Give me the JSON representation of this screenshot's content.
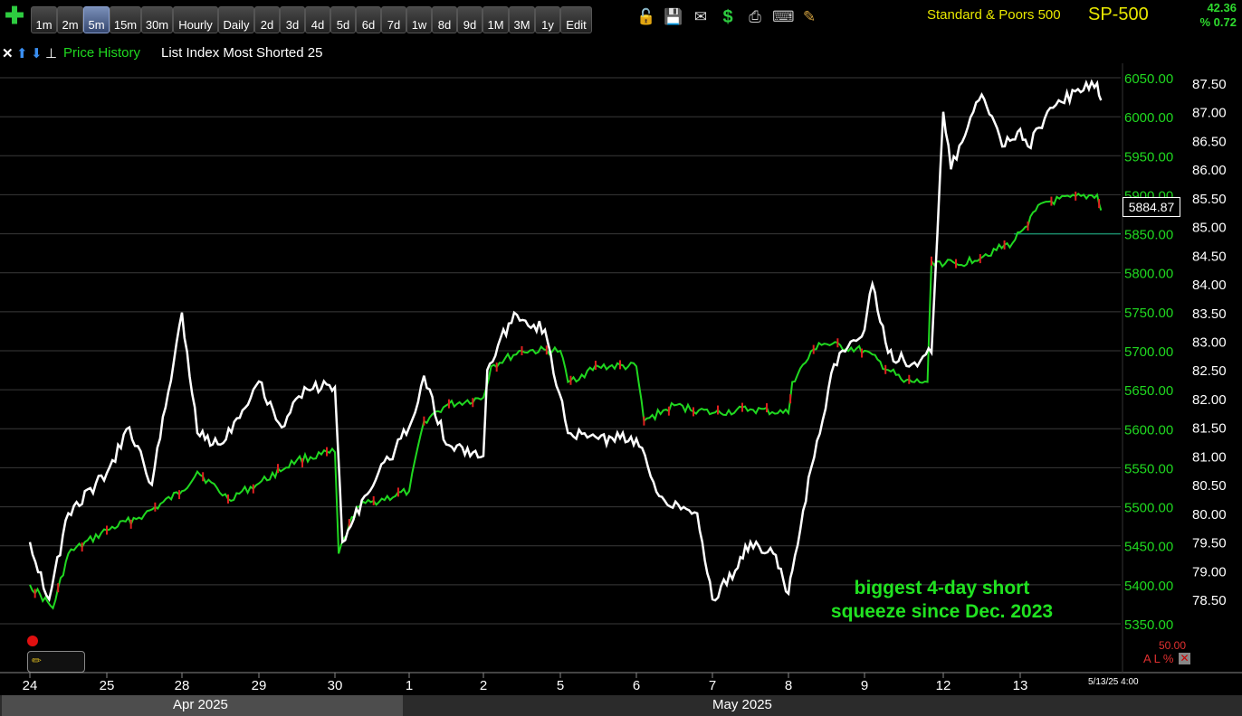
{
  "toolbar": {
    "timeframes": [
      "1m",
      "2m",
      "5m",
      "15m",
      "30m",
      "Hourly",
      "Daily",
      "2d",
      "3d",
      "4d",
      "5d",
      "6d",
      "7d",
      "1w",
      "8d",
      "9d",
      "1M",
      "3M",
      "1y",
      "Edit"
    ],
    "active": "5m",
    "icons": [
      "plus-icon",
      "lock-icon",
      "save-icon",
      "mail-icon",
      "dollar-icon",
      "print-icon",
      "keyboard-icon",
      "pencil-icon"
    ],
    "symbol_name": "Standard & Poors 500",
    "symbol": "SP-500",
    "change": "42.36",
    "change_pct": "% 0.72",
    "accent": "#e8e800",
    "up_color": "#2edb2e"
  },
  "legend": {
    "icons": [
      "close-icon",
      "arrow-up-icon",
      "arrow-down-icon",
      "pin-icon"
    ],
    "series1": "Price History",
    "series2": "List Index Most Shorted 25"
  },
  "annotation": "biggest 4-day short squeeze since Dec. 2023",
  "last_value": "5884.87",
  "pct_value": "50.00",
  "al_label": "A L %",
  "timestamp": "5/13/25 4:00",
  "months": [
    "Apr 2025",
    "May 2025"
  ],
  "chart_data": {
    "type": "line",
    "x_days": [
      "24",
      "25",
      "28",
      "29",
      "30",
      "1",
      "2",
      "5",
      "6",
      "7",
      "8",
      "9",
      "12",
      "13"
    ],
    "y_left": {
      "label": "",
      "ticks": [
        "6050.00",
        "6000.00",
        "5950.00",
        "5900.00",
        "5850.00",
        "5800.00",
        "5750.00",
        "5700.00",
        "5650.00",
        "5600.00",
        "5550.00",
        "5500.00",
        "5450.00",
        "5400.00",
        "5350.00"
      ],
      "range": [
        5350,
        6050
      ]
    },
    "y_right": {
      "label": "",
      "ticks": [
        "87.50",
        "87.00",
        "86.50",
        "86.00",
        "85.50",
        "85.00",
        "84.50",
        "84.00",
        "83.50",
        "83.00",
        "82.50",
        "82.00",
        "81.50",
        "81.00",
        "80.50",
        "80.00",
        "79.50",
        "79.00",
        "78.50"
      ],
      "range": [
        78.5,
        87.5
      ]
    },
    "series": [
      {
        "name": "Price History",
        "axis": "left",
        "color": "#20d820",
        "values": [
          [
            0,
            5400
          ],
          [
            0.3,
            5370
          ],
          [
            0.5,
            5440
          ],
          [
            1,
            5470
          ],
          [
            1.5,
            5490
          ],
          [
            2,
            5520
          ],
          [
            2.2,
            5545
          ],
          [
            2.6,
            5510
          ],
          [
            3,
            5530
          ],
          [
            3.5,
            5560
          ],
          [
            4,
            5570
          ],
          [
            4.05,
            5440
          ],
          [
            4.3,
            5500
          ],
          [
            5,
            5520
          ],
          [
            5.2,
            5610
          ],
          [
            5.5,
            5630
          ],
          [
            6,
            5640
          ],
          [
            6.1,
            5680
          ],
          [
            6.5,
            5700
          ],
          [
            7,
            5700
          ],
          [
            7.1,
            5660
          ],
          [
            7.5,
            5680
          ],
          [
            8,
            5680
          ],
          [
            8.1,
            5610
          ],
          [
            8.5,
            5630
          ],
          [
            9,
            5620
          ],
          [
            9.5,
            5625
          ],
          [
            10,
            5620
          ],
          [
            10.05,
            5660
          ],
          [
            10.4,
            5710
          ],
          [
            11,
            5700
          ],
          [
            11.5,
            5660
          ],
          [
            11.8,
            5660
          ],
          [
            11.85,
            5815
          ],
          [
            12.2,
            5810
          ],
          [
            12.9,
            5838
          ],
          [
            13,
            5852
          ],
          [
            13.3,
            5890
          ],
          [
            14,
            5900
          ],
          [
            14.05,
            5880
          ]
        ]
      },
      {
        "name": "List Index Most Shorted 25",
        "axis": "right",
        "color": "#ffffff",
        "values": [
          [
            0,
            79.5
          ],
          [
            0.25,
            78.5
          ],
          [
            0.5,
            80
          ],
          [
            1,
            80.7
          ],
          [
            1.3,
            81.5
          ],
          [
            1.6,
            80.5
          ],
          [
            2,
            83.5
          ],
          [
            2.2,
            81.4
          ],
          [
            2.5,
            81.2
          ],
          [
            3,
            82.3
          ],
          [
            3.3,
            81.5
          ],
          [
            3.6,
            82.2
          ],
          [
            4,
            82.2
          ],
          [
            4.1,
            79.5
          ],
          [
            4.4,
            80.3
          ],
          [
            5,
            81.5
          ],
          [
            5.2,
            82.4
          ],
          [
            5.5,
            81.2
          ],
          [
            6,
            81
          ],
          [
            6.05,
            82.5
          ],
          [
            6.4,
            83.5
          ],
          [
            6.8,
            83.2
          ],
          [
            7.1,
            81.4
          ],
          [
            7.5,
            81.3
          ],
          [
            8,
            81.3
          ],
          [
            8.3,
            80.3
          ],
          [
            8.8,
            80
          ],
          [
            9,
            78.5
          ],
          [
            9.3,
            79
          ],
          [
            9.5,
            79.5
          ],
          [
            9.8,
            79.3
          ],
          [
            10,
            78.6
          ],
          [
            10.05,
            79
          ],
          [
            10.3,
            80.8
          ],
          [
            10.6,
            82.6
          ],
          [
            11,
            83.2
          ],
          [
            11.1,
            84
          ],
          [
            11.3,
            82.8
          ],
          [
            11.6,
            82.6
          ],
          [
            11.85,
            82.8
          ],
          [
            12,
            87
          ],
          [
            12.1,
            86
          ],
          [
            12.5,
            87.3
          ],
          [
            12.8,
            86.4
          ],
          [
            13,
            86.7
          ],
          [
            13.1,
            86.4
          ],
          [
            13.5,
            87.2
          ],
          [
            14,
            87.5
          ],
          [
            14.05,
            87.2
          ]
        ]
      }
    ],
    "reference_value": 5850,
    "reference_color": "#1a8a6a",
    "grid": true
  }
}
